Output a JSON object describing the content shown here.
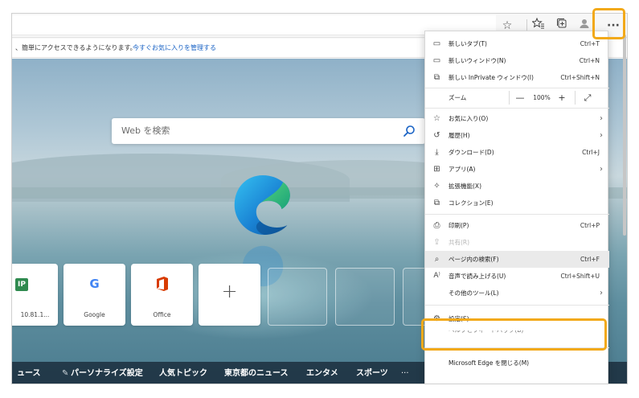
{
  "favorites_bar": {
    "message": "、簡単にアクセスできるようになります。",
    "link": "今すぐお気に入りを管理する"
  },
  "toolbar": {
    "icons": [
      "star-icon",
      "favorites-icon",
      "collections-icon",
      "profile-icon",
      "more-icon"
    ],
    "more_label": "···"
  },
  "new_tab": {
    "search_placeholder": "Web を検索",
    "tiles": [
      {
        "label": "10.81.1...",
        "icon_text": "IP",
        "color": "#2f8a4f"
      },
      {
        "label": "Google",
        "icon_text": "G",
        "color": "#4285f4"
      },
      {
        "label": "Office",
        "icon_text": "O",
        "color": "#d83b01"
      },
      {
        "label": "",
        "icon_text": "+",
        "color": "#555555"
      }
    ],
    "news": [
      "ュース",
      "パーソナライズ設定",
      "人気トピック",
      "東京都のニュース",
      "エンタメ",
      "スポーツ",
      "···"
    ]
  },
  "menu": {
    "items": [
      {
        "label": "新しいタブ(T)",
        "shortcut": "Ctrl+T",
        "icon": "new-tab-icon"
      },
      {
        "label": "新しいウィンドウ(N)",
        "shortcut": "Ctrl+N",
        "icon": "new-window-icon"
      },
      {
        "label": "新しい InPrivate ウィンドウ(I)",
        "shortcut": "Ctrl+Shift+N",
        "icon": "inprivate-icon"
      },
      {
        "label": "ズーム",
        "icon": "zoom"
      },
      {
        "label": "お気に入り(O)",
        "icon": "favorites-icon"
      },
      {
        "label": "履歴(H)",
        "icon": "history-icon"
      },
      {
        "label": "ダウンロード(D)",
        "shortcut": "Ctrl+J",
        "icon": "download-icon"
      },
      {
        "label": "アプリ(A)",
        "icon": "apps-icon"
      },
      {
        "label": "拡張機能(X)",
        "icon": "extensions-icon"
      },
      {
        "label": "コレクション(E)",
        "icon": "collections-icon"
      },
      {
        "label": "印刷(P)",
        "shortcut": "Ctrl+P",
        "icon": "print-icon"
      },
      {
        "label": "共有(R)",
        "icon": "share-icon"
      },
      {
        "label": "ページ内の検索(F)",
        "shortcut": "Ctrl+F",
        "icon": "find-icon"
      },
      {
        "label": "音声で読み上げる(U)",
        "shortcut": "Ctrl+Shift+U",
        "icon": "read-aloud-icon"
      },
      {
        "label": "その他のツール(L)",
        "icon": "more-tools-icon"
      },
      {
        "label": "設定(S)",
        "icon": "settings-icon"
      },
      {
        "label": "ヘルプとフィードバック(B)",
        "icon": "help-icon"
      },
      {
        "label": "Microsoft Edge を閉じる(M)",
        "icon": "close-icon"
      }
    ],
    "zoom": {
      "minus": "—",
      "value": "100%",
      "plus": "+",
      "fullscreen": "⤢"
    }
  },
  "highlight_color": "#f2a91a"
}
